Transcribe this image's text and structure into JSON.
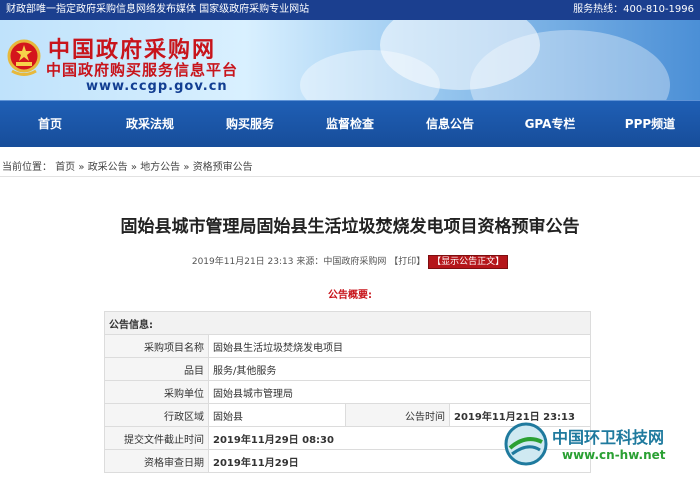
{
  "topbar": {
    "left": "财政部唯一指定政府采购信息网络发布媒体 国家级政府采购专业网站",
    "right": "服务热线：400-810-1996"
  },
  "banner": {
    "logo_title": "中国政府采购网",
    "logo_subtitle": "中国政府购买服务信息平台",
    "logo_url": "www.ccgp.gov.cn"
  },
  "nav": {
    "items": [
      "首页",
      "政采法规",
      "购买服务",
      "监督检查",
      "信息公告",
      "GPA专栏",
      "PPP频道"
    ]
  },
  "breadcrumb": {
    "prefix": "当前位置：",
    "items": [
      "首页",
      "政采公告",
      "地方公告",
      "资格预审公告"
    ],
    "separator": "»"
  },
  "article": {
    "title": "固始县城市管理局固始县生活垃圾焚烧发电项目资格预审公告",
    "meta_datetime": "2019年11月21日 23:13",
    "meta_source": "来源：中国政府采购网",
    "meta_print": "【打印】",
    "show_notice_button": "【显示公告正文】",
    "summary_title": "公告概要:"
  },
  "info_table": {
    "header": "公告信息:",
    "rows": [
      {
        "label": "采购项目名称",
        "value": "固始县生活垃圾焚烧发电项目"
      },
      {
        "label": "品目",
        "value": "服务/其他服务"
      },
      {
        "label": "采购单位",
        "value": "固始县城市管理局"
      },
      {
        "label": "行政区域",
        "value": "固始县",
        "label2": "公告时间",
        "value2": "2019年11月21日 23:13"
      },
      {
        "label": "提交文件截止时间",
        "value": "2019年11月29日 08:30"
      },
      {
        "label": "资格审查日期",
        "value": "2019年11月29日"
      }
    ]
  },
  "watermark": {
    "name": "中国环卫科技网",
    "url": "www.cn-hw.net"
  },
  "colors": {
    "topbar_bg": "#1b3f8f",
    "nav_bg": "#1f5fb5",
    "logo_red": "#c8141b",
    "accent_red_button": "#b5161a"
  }
}
